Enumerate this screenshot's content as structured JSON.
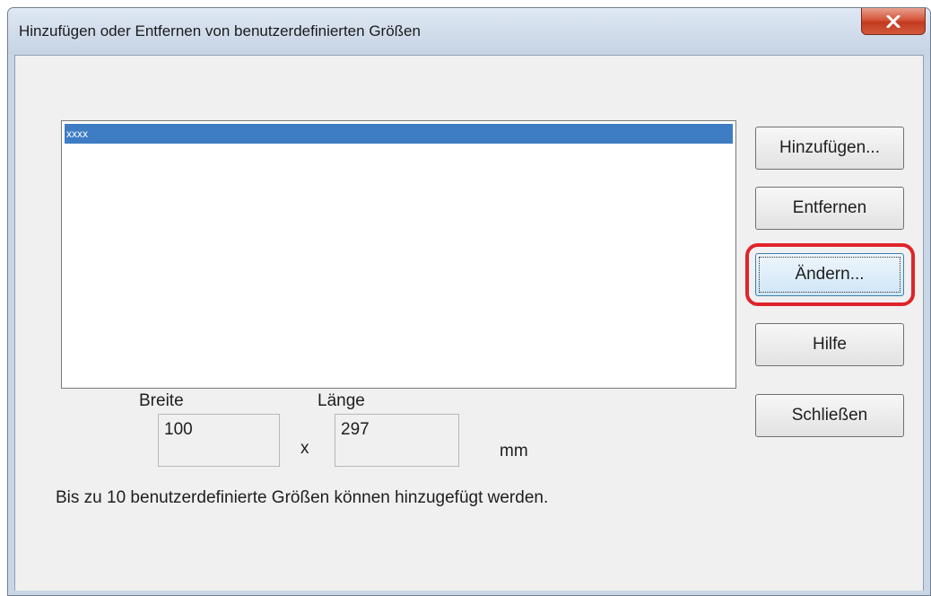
{
  "window": {
    "title": "Hinzufügen oder Entfernen von benutzerdefinierten Größen",
    "close_icon": "close-icon"
  },
  "list": {
    "items": [
      {
        "label": "xxxx",
        "selected": true
      }
    ]
  },
  "buttons": {
    "add_label": "Hinzufügen...",
    "remove_label": "Entfernen",
    "change_label": "Ändern...",
    "help_label": "Hilfe",
    "close_label": "Schließen"
  },
  "size": {
    "width_label": "Breite",
    "length_label": "Länge",
    "width_value": "100",
    "separator": "x",
    "length_value": "297",
    "unit": "mm"
  },
  "note": "Bis zu 10 benutzerdefinierte Größen können hinzugefügt werden.",
  "colors": {
    "selection": "#3e7cc3",
    "highlight_ring": "#e0232a",
    "close_button": "#c9462b"
  }
}
